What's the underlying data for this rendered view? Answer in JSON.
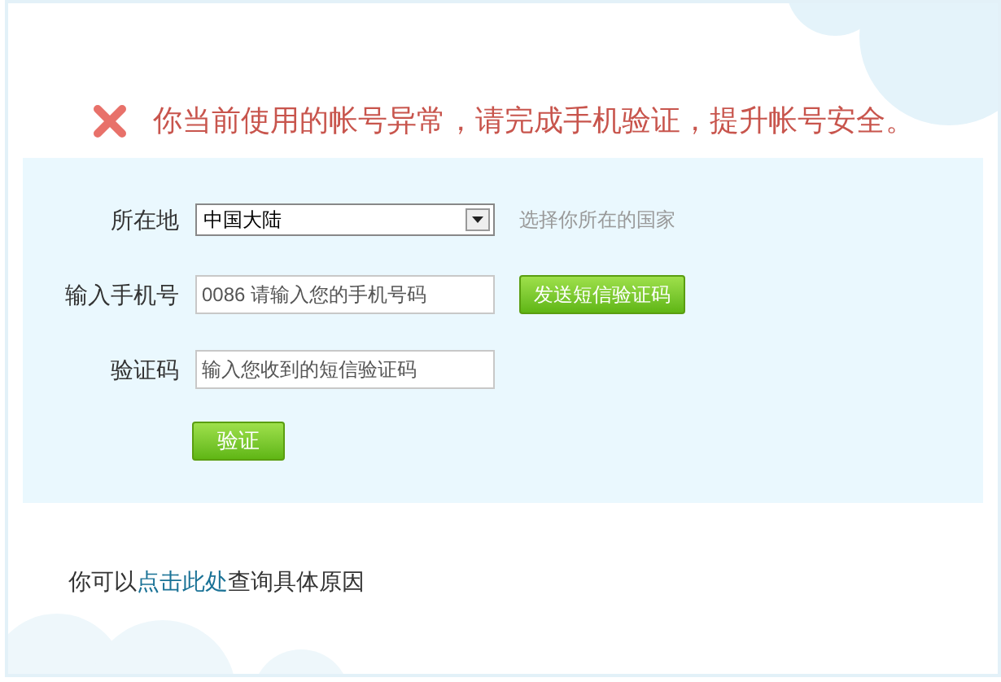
{
  "alert": {
    "message": "你当前使用的帐号异常，请完成手机验证，提升帐号安全。"
  },
  "form": {
    "fields": [
      {
        "kind": "select",
        "label": "所在地",
        "value": "中国大陆",
        "hint": "选择你所在的国家"
      },
      {
        "kind": "input",
        "label": "输入手机号",
        "placeholder": "0086 请输入您的手机号码",
        "button": "发送短信验证码"
      },
      {
        "kind": "input",
        "label": "验证码",
        "placeholder": "输入您收到的短信验证码"
      }
    ],
    "submit": "验证"
  },
  "footer": {
    "before": "你可以",
    "link": "点击此处",
    "after": "查询具体原因"
  }
}
